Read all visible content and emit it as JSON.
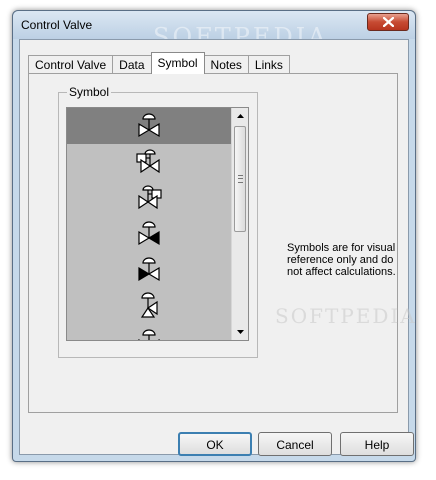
{
  "window": {
    "title": "Control Valve",
    "watermark": "SOFTPEDIA"
  },
  "tabs": [
    {
      "label": "Control Valve",
      "active": false
    },
    {
      "label": "Data",
      "active": false
    },
    {
      "label": "Symbol",
      "active": true
    },
    {
      "label": "Notes",
      "active": false
    },
    {
      "label": "Links",
      "active": false
    }
  ],
  "symbol_group": {
    "label": "Symbol",
    "items": [
      {
        "icon": "valve-diaphragm-icon",
        "selected": true
      },
      {
        "icon": "valve-positioner-icon",
        "selected": false
      },
      {
        "icon": "valve-angle-positioner-icon",
        "selected": false
      },
      {
        "icon": "valve-closed-right-icon",
        "selected": false
      },
      {
        "icon": "valve-closed-left-icon",
        "selected": false
      },
      {
        "icon": "valve-angle-icon",
        "selected": false
      },
      {
        "icon": "valve-partial-icon",
        "selected": false
      }
    ]
  },
  "note": {
    "text": "Symbols are for visual reference only and do not affect calculations."
  },
  "buttons": {
    "ok": "OK",
    "cancel": "Cancel",
    "help": "Help"
  },
  "colors": {
    "selected_item": "#808080",
    "list_background": "#c0c0c0",
    "close_button": "#c74b33"
  }
}
